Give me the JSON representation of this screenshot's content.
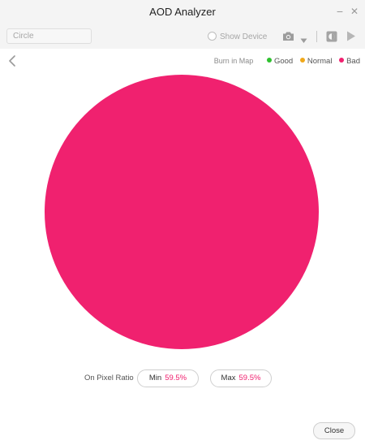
{
  "window": {
    "title": "AOD Analyzer",
    "minimize_glyph": "−",
    "close_glyph": "✕"
  },
  "toolbar": {
    "shape_value": "Circle",
    "show_device_label": "Show Device",
    "show_device_checked": false,
    "icons": [
      "camera-icon",
      "chevron-down-icon",
      "screen-toggle-icon",
      "play-icon"
    ]
  },
  "legend": {
    "map_label": "Burn in Map",
    "items": [
      {
        "label": "Good",
        "color": "#2fc12f"
      },
      {
        "label": "Normal",
        "color": "#f0a81a"
      },
      {
        "label": "Bad",
        "color": "#f0216f"
      }
    ]
  },
  "burn_map": {
    "shape": "circle",
    "fill_color": "#f0216f",
    "status": "Bad"
  },
  "pixel_ratio": {
    "label": "On Pixel Ratio",
    "min_label": "Min",
    "min_value": "59.5%",
    "max_label": "Max",
    "max_value": "59.5%"
  },
  "footer": {
    "close_label": "Close"
  }
}
